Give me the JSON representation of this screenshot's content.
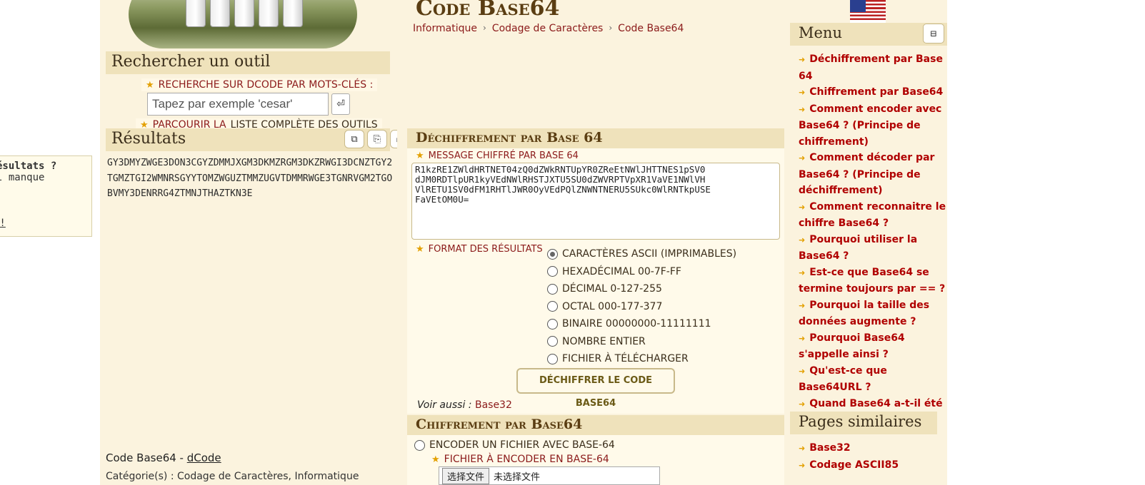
{
  "search": {
    "heading": "Rechercher un outil",
    "keywords_label": "RECHERCHE SUR DCODE PAR MOTS-CLÉS :",
    "placeholder": "Tapez par exemple 'cesar'",
    "go_icon": "⏎",
    "browse_prefix": "PARCOURIR LA",
    "browse_link": "LISTE COMPLÈTE DES OUTILS"
  },
  "results": {
    "heading": "Résultats",
    "tools": [
      "⧉",
      "⎘",
      "⎙",
      "⤓",
      "📌",
      "✖"
    ],
    "text": "GY3DMYZWGE3DON3CGYZDMMJXGM3DKMZRGM3DKZRWGI3DCNZTGY2TGMZTGI2WMNRSGYYTOMZWGUZTMMZUGVTDMMRWGE3TGNRVGM2TGOBVMY3DENRRG4ZTMNJTHAZTKN3E"
  },
  "tooltip": {
    "title": "ésultats ?",
    "line": "l manque",
    "link": "_!"
  },
  "footer": {
    "prefix": "Code Base64 - ",
    "link": "dCode",
    "line2": "Catégorie(s) : Codage de Caractères, Informatique"
  },
  "page": {
    "title": "Code Base64",
    "breadcrumb": [
      "Informatique",
      "Codage de Caractères",
      "Code Base64"
    ]
  },
  "decrypt": {
    "heading": "Déchiffrement par Base 64",
    "message_label": "MESSAGE CHIFFRÉ PAR BASE 64",
    "message": "R1kzRE1ZWldHRTNET04zQ0dZWkRNTUpYR0ZReEtNWlJHTTNES1pSV0\ndJM0RDTlpUR1kyVEdNWlRHSTJXTU5SU0dZWVRPTVpXR1VaVE1NWlVH\nVlRETU1SV0dFM1RHTlJWR0OyVEdPQlZNWNTNERU5SUkc0WlRNTkpUSE\nFaVEtOM0U=",
    "format_label": "FORMAT DES RÉSULTATS",
    "formats": [
      {
        "label": "CARACTÈRES ASCII (IMPRIMABLES)",
        "selected": true
      },
      {
        "label": "HEXADÉCIMAL 00-7F-FF",
        "selected": false
      },
      {
        "label": "DÉCIMAL 0-127-255",
        "selected": false
      },
      {
        "label": "OCTAL 000-177-377",
        "selected": false
      },
      {
        "label": "BINAIRE 00000000-11111111",
        "selected": false
      },
      {
        "label": "NOMBRE ENTIER",
        "selected": false
      },
      {
        "label": "FICHIER À TÉLÉCHARGER",
        "selected": false
      }
    ],
    "button": "DÉCHIFFRER LE CODE BASE64",
    "see_also_prefix": "Voir aussi : ",
    "see_also_link": "Base32"
  },
  "encrypt": {
    "heading": "Chiffrement par Base64",
    "option": "ENCODER UN FICHIER AVEC BASE-64",
    "file_label": "FICHIER À ENCODER EN BASE-64",
    "file_button": "选择文件",
    "file_status": "未选择文件"
  },
  "menu": {
    "heading": "Menu",
    "toggle_icon": "⊟",
    "items": [
      "Déchiffrement par Base 64",
      "Chiffrement par Base64",
      "Comment encoder avec Base64 ? (Principe de chiffrement)",
      "Comment décoder par Base64 ? (Principe de déchiffrement)",
      "Comment reconnaitre le chiffre Base64 ?",
      "Pourquoi utiliser la Base64 ?",
      "Est-ce que Base64 se termine toujours par == ?",
      "Pourquoi la taille des données augmente ?",
      "Pourquoi Base64 s'appelle ainsi ?",
      "Qu'est-ce que Base64URL ?",
      "Quand Base64 a-t-il été inventé ?"
    ]
  },
  "similar": {
    "heading": "Pages similaires",
    "items": [
      "Base32",
      "Codage ASCII85"
    ]
  },
  "colors": {
    "panel_bg": "#fbf3de",
    "header_bg": "#efe2bb",
    "link_red": "#b00000",
    "title_brown": "#5a3d12"
  }
}
